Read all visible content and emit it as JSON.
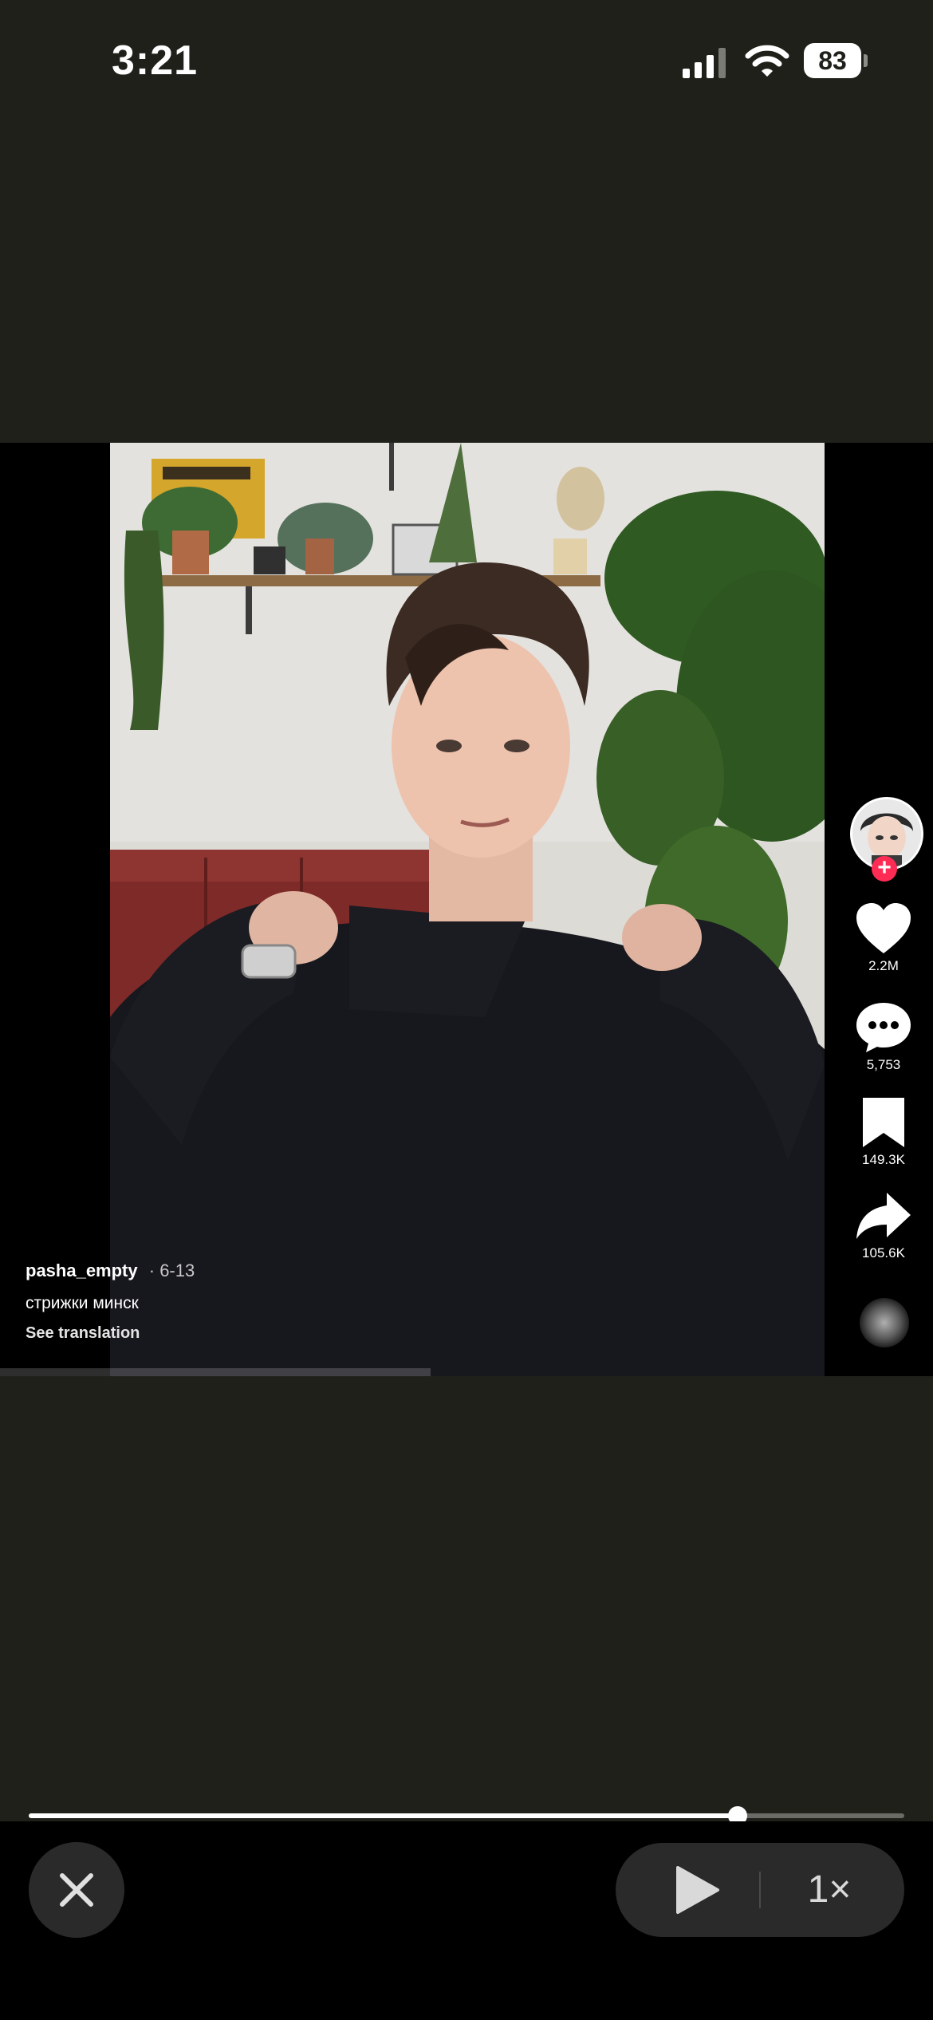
{
  "status_bar": {
    "time": "3:21",
    "battery": "83"
  },
  "video": {
    "username": "pasha_empty",
    "date": "· 6-13",
    "description": "стрижки минск",
    "translate": "See translation",
    "actions": {
      "likes": "2.2M",
      "comments": "5,753",
      "saves": "149.3K",
      "shares": "105.6K"
    },
    "avatar_follow": "+"
  },
  "player": {
    "progress": 0.81,
    "speed": "1×"
  },
  "colors": {
    "background": "#20201b",
    "follow_badge": "#fe2c55"
  }
}
